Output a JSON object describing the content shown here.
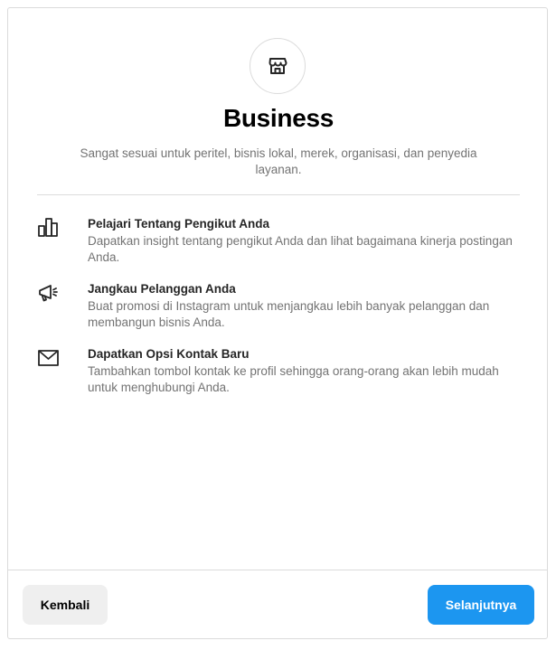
{
  "header": {
    "icon": "storefront-icon",
    "title": "Business",
    "subtitle": "Sangat sesuai untuk peritel, bisnis lokal, merek, organisasi, dan penyedia layanan."
  },
  "features": [
    {
      "icon": "bar-chart-icon",
      "title": "Pelajari Tentang Pengikut Anda",
      "description": "Dapatkan insight tentang pengikut Anda dan lihat bagaimana kinerja postingan Anda."
    },
    {
      "icon": "megaphone-icon",
      "title": "Jangkau Pelanggan Anda",
      "description": "Buat promosi di Instagram untuk menjangkau lebih banyak pelanggan dan membangun bisnis Anda."
    },
    {
      "icon": "envelope-icon",
      "title": "Dapatkan Opsi Kontak Baru",
      "description": "Tambahkan tombol kontak ke profil sehingga orang-orang akan lebih mudah untuk menghubungi Anda."
    }
  ],
  "footer": {
    "back_label": "Kembali",
    "next_label": "Selanjutnya"
  },
  "colors": {
    "primary_button": "#1c96f0",
    "secondary_button": "#efefef",
    "muted_text": "#737373",
    "border": "#dbdbdb"
  }
}
